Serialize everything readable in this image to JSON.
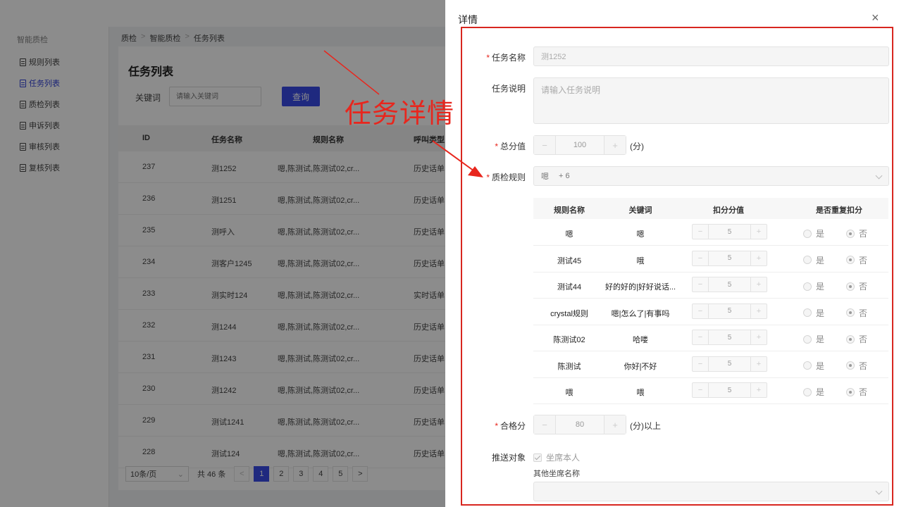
{
  "sidebar": {
    "title": "智能质检",
    "items": [
      {
        "label": "规则列表",
        "active": false
      },
      {
        "label": "任务列表",
        "active": true
      },
      {
        "label": "质检列表",
        "active": false
      },
      {
        "label": "申诉列表",
        "active": false
      },
      {
        "label": "审核列表",
        "active": false
      },
      {
        "label": "复核列表",
        "active": false
      }
    ]
  },
  "breadcrumb": [
    "质检",
    "智能质检",
    "任务列表"
  ],
  "page": {
    "title": "任务列表",
    "keyword_label": "关键词",
    "keyword_placeholder": "请输入关键词",
    "query_button": "查询"
  },
  "table": {
    "columns": [
      "ID",
      "任务名称",
      "规则名称",
      "呼叫类型"
    ],
    "rows": [
      {
        "id": "237",
        "name": "测1252",
        "rules": "嗯,陈测试,陈测试02,cr...",
        "type": "历史话单"
      },
      {
        "id": "236",
        "name": "测1251",
        "rules": "嗯,陈测试,陈测试02,cr...",
        "type": "历史话单"
      },
      {
        "id": "235",
        "name": "测呼入",
        "rules": "嗯,陈测试,陈测试02,cr...",
        "type": "历史话单"
      },
      {
        "id": "234",
        "name": "测客户1245",
        "rules": "嗯,陈测试,陈测试02,cr...",
        "type": "历史话单"
      },
      {
        "id": "233",
        "name": "测实时124",
        "rules": "嗯,陈测试,陈测试02,cr...",
        "type": "实时话单"
      },
      {
        "id": "232",
        "name": "测1244",
        "rules": "嗯,陈测试,陈测试02,cr...",
        "type": "历史话单"
      },
      {
        "id": "231",
        "name": "测1243",
        "rules": "嗯,陈测试,陈测试02,cr...",
        "type": "历史话单"
      },
      {
        "id": "230",
        "name": "测1242",
        "rules": "嗯,陈测试,陈测试02,cr...",
        "type": "历史话单"
      },
      {
        "id": "229",
        "name": "测试1241",
        "rules": "嗯,陈测试,陈测试02,cr...",
        "type": "历史话单"
      },
      {
        "id": "228",
        "name": "测试124",
        "rules": "嗯,陈测试,陈测试02,cr...",
        "type": "历史话单"
      }
    ]
  },
  "pagination": {
    "page_size": "10条/页",
    "total": "共 46 条",
    "prev": "<",
    "pages": [
      "1",
      "2",
      "3",
      "4",
      "5"
    ],
    "current": "1",
    "next": ">"
  },
  "annotation": {
    "text": "任务详情",
    "color": "#e8261d"
  },
  "drawer": {
    "title": "详情",
    "close_icon": "×",
    "task_name_label": "任务名称",
    "task_name_value": "测1252",
    "task_desc_label": "任务说明",
    "task_desc_placeholder": "请输入任务说明",
    "total_score_label": "总分值",
    "total_score_value": "100",
    "total_score_unit": "(分)",
    "rules_label": "质检规则",
    "rules_tag": "嗯",
    "rules_more": "+ 6",
    "rule_table": {
      "columns": [
        "规则名称",
        "关键词",
        "扣分分值",
        "是否重复扣分"
      ],
      "rows": [
        {
          "name": "嗯",
          "keyword": "嗯",
          "score": "5",
          "yes": "是",
          "no": "否"
        },
        {
          "name": "测试45",
          "keyword": "哦",
          "score": "5",
          "yes": "是",
          "no": "否"
        },
        {
          "name": "测试44",
          "keyword": "好的好的|好好说话...",
          "score": "5",
          "yes": "是",
          "no": "否"
        },
        {
          "name": "crystal规则",
          "keyword": "嗯|怎么了|有事吗",
          "score": "5",
          "yes": "是",
          "no": "否"
        },
        {
          "name": "陈测试02",
          "keyword": "哈喽",
          "score": "5",
          "yes": "是",
          "no": "否"
        },
        {
          "name": "陈测试",
          "keyword": "你好|不好",
          "score": "5",
          "yes": "是",
          "no": "否"
        },
        {
          "name": "喂",
          "keyword": "喂",
          "score": "5",
          "yes": "是",
          "no": "否"
        }
      ]
    },
    "pass_score_label": "合格分",
    "pass_score_value": "80",
    "pass_score_unit": "(分)以上",
    "push_label": "推送对象",
    "push_checkbox": "坐席本人",
    "other_agents_label": "其他坐席名称",
    "stepper_minus": "−",
    "stepper_plus": "+"
  }
}
